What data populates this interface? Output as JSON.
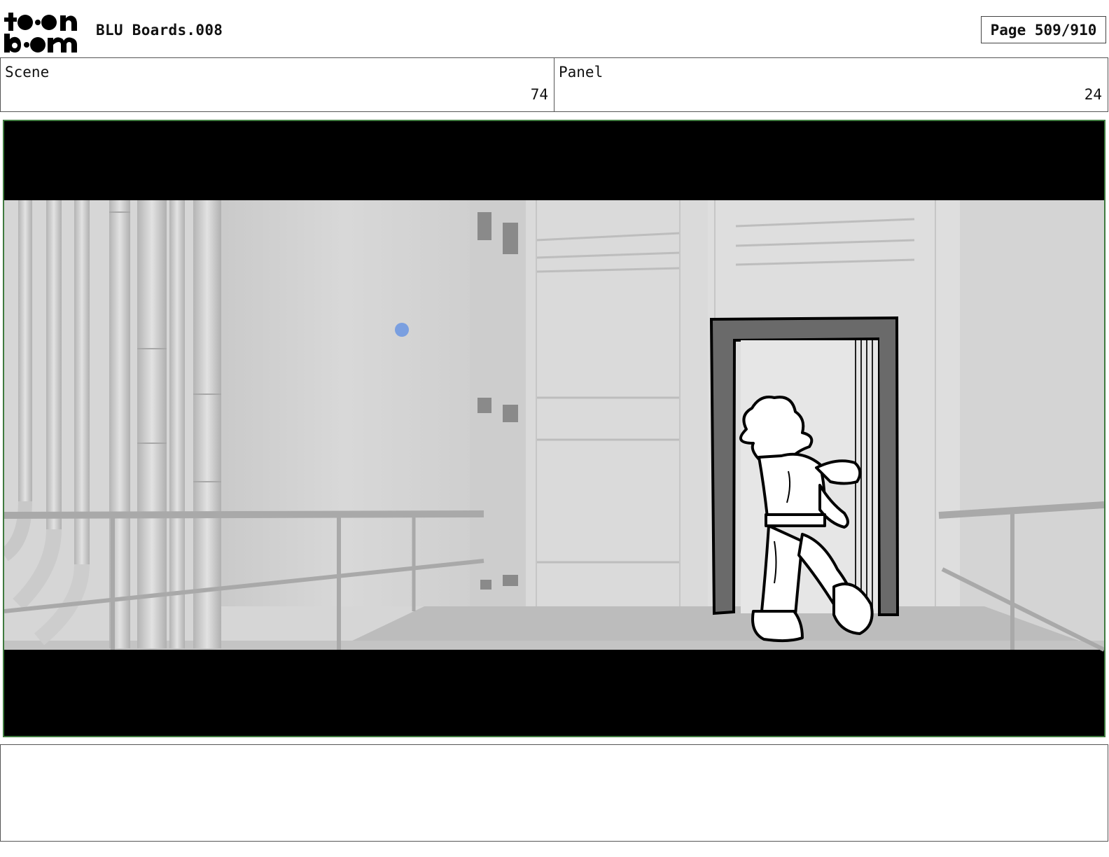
{
  "header": {
    "logo_text": "toon boom",
    "title": "BLU Boards.008",
    "page_label": "Page 509/910"
  },
  "scene": {
    "label": "Scene",
    "value": "74"
  },
  "panel": {
    "label": "Panel",
    "value": "24"
  },
  "notes": {
    "text": ""
  },
  "colors": {
    "frame_border": "#3f7a3f",
    "marker": "#7a9fe0"
  }
}
